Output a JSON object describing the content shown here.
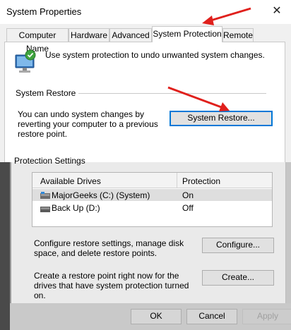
{
  "window": {
    "title": "System Properties",
    "close_glyph": "✕"
  },
  "tabs": [
    {
      "label": "Computer Name"
    },
    {
      "label": "Hardware"
    },
    {
      "label": "Advanced"
    },
    {
      "label": "System Protection"
    },
    {
      "label": "Remote"
    }
  ],
  "active_tab": "System Protection",
  "intro": {
    "icon": "system-protection-icon",
    "text": "Use system protection to undo unwanted system changes."
  },
  "system_restore": {
    "group_label": "System Restore",
    "description": "You can undo system changes by reverting your computer to a previous restore point.",
    "button_label": "System Restore..."
  },
  "protection_settings": {
    "group_label": "Protection Settings",
    "columns": [
      "Available Drives",
      "Protection"
    ],
    "drives": [
      {
        "name": "MajorGeeks (C:) (System)",
        "protection": "On",
        "icon": "system-drive-icon",
        "selected": true
      },
      {
        "name": "Back Up (D:)",
        "protection": "Off",
        "icon": "drive-icon",
        "selected": false
      }
    ],
    "configure": {
      "description": "Configure restore settings, manage disk space, and delete restore points.",
      "button_label": "Configure..."
    },
    "create": {
      "description": "Create a restore point right now for the drives that have system protection turned on.",
      "button_label": "Create..."
    }
  },
  "footer": {
    "ok_label": "OK",
    "cancel_label": "Cancel",
    "apply_label": "Apply"
  },
  "colors": {
    "annotation_arrow": "#e0201c",
    "focus_border": "#0078d7"
  }
}
